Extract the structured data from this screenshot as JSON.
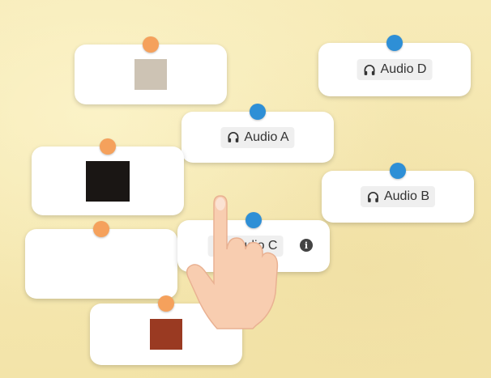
{
  "board": {
    "cards": [
      {
        "id": "image-1",
        "type": "image",
        "pin": "orange",
        "swatch": "#cdc3b4"
      },
      {
        "id": "audio-d",
        "type": "audio",
        "pin": "blue",
        "label": "Audio D"
      },
      {
        "id": "audio-a",
        "type": "audio",
        "pin": "blue",
        "label": "Audio A"
      },
      {
        "id": "image-2",
        "type": "image",
        "pin": "orange",
        "swatch": "#1a1614"
      },
      {
        "id": "audio-b",
        "type": "audio",
        "pin": "blue",
        "label": "Audio B"
      },
      {
        "id": "image-3",
        "type": "image",
        "pin": "orange",
        "swatch": "#ffffff"
      },
      {
        "id": "audio-c",
        "type": "audio",
        "pin": "blue",
        "label": "Audio C",
        "info_icon": "info-icon"
      },
      {
        "id": "image-4",
        "type": "image",
        "pin": "orange",
        "swatch": "#9a3a22"
      }
    ]
  },
  "icons": {
    "audio": "headphones-icon",
    "info": "info-icon",
    "pointer": "hand-pointer"
  },
  "colors": {
    "background": "#f6e9b4",
    "pin_orange": "#f5a15c",
    "pin_blue": "#2e8fd6",
    "card": "#ffffff"
  }
}
